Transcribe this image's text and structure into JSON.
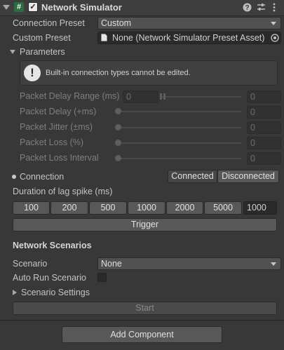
{
  "component": {
    "title": "Network Simulator",
    "script_icon": "#",
    "enabled_check": "✓",
    "header_icons": [
      "help-icon",
      "preset-icon",
      "kebab-menu-icon"
    ]
  },
  "connection_preset": {
    "label": "Connection Preset",
    "value": "Custom"
  },
  "custom_preset": {
    "label": "Custom Preset",
    "value": "None (Network Simulator Preset Asset)"
  },
  "parameters": {
    "label": "Parameters",
    "help_icon_glyph": "!",
    "help_text": "Built-in connection types cannot be edited.",
    "packet_delay_range": {
      "label": "Packet Delay Range (ms)",
      "min": "0",
      "max": "0"
    },
    "packet_delay": {
      "label": "Packet Delay (+ms)",
      "value": "0"
    },
    "packet_jitter": {
      "label": "Packet Jitter (±ms)",
      "value": "0"
    },
    "packet_loss": {
      "label": "Packet Loss (%)",
      "value": "0"
    },
    "packet_loss_interval": {
      "label": "Packet Loss Interval",
      "value": "0"
    }
  },
  "connection": {
    "label": "Connection",
    "connected": "Connected",
    "disconnected": "Disconnected",
    "selected": "Connected"
  },
  "lag_spike": {
    "label": "Duration of lag spike (ms)",
    "options": [
      "100",
      "200",
      "500",
      "1000",
      "2000",
      "5000"
    ],
    "value": "1000",
    "trigger": "Trigger"
  },
  "network_scenarios": {
    "heading": "Network Scenarios",
    "scenario_label": "Scenario",
    "scenario_value": "None",
    "auto_run_label": "Auto Run Scenario",
    "auto_run_checked": false,
    "settings_label": "Scenario Settings",
    "start": "Start"
  },
  "add_component": "Add Component",
  "colors": {
    "panel_bg": "#383838",
    "field_bg": "#2a2a2a",
    "button_bg": "#585858",
    "script_icon_bg": "#2f6b3f"
  }
}
